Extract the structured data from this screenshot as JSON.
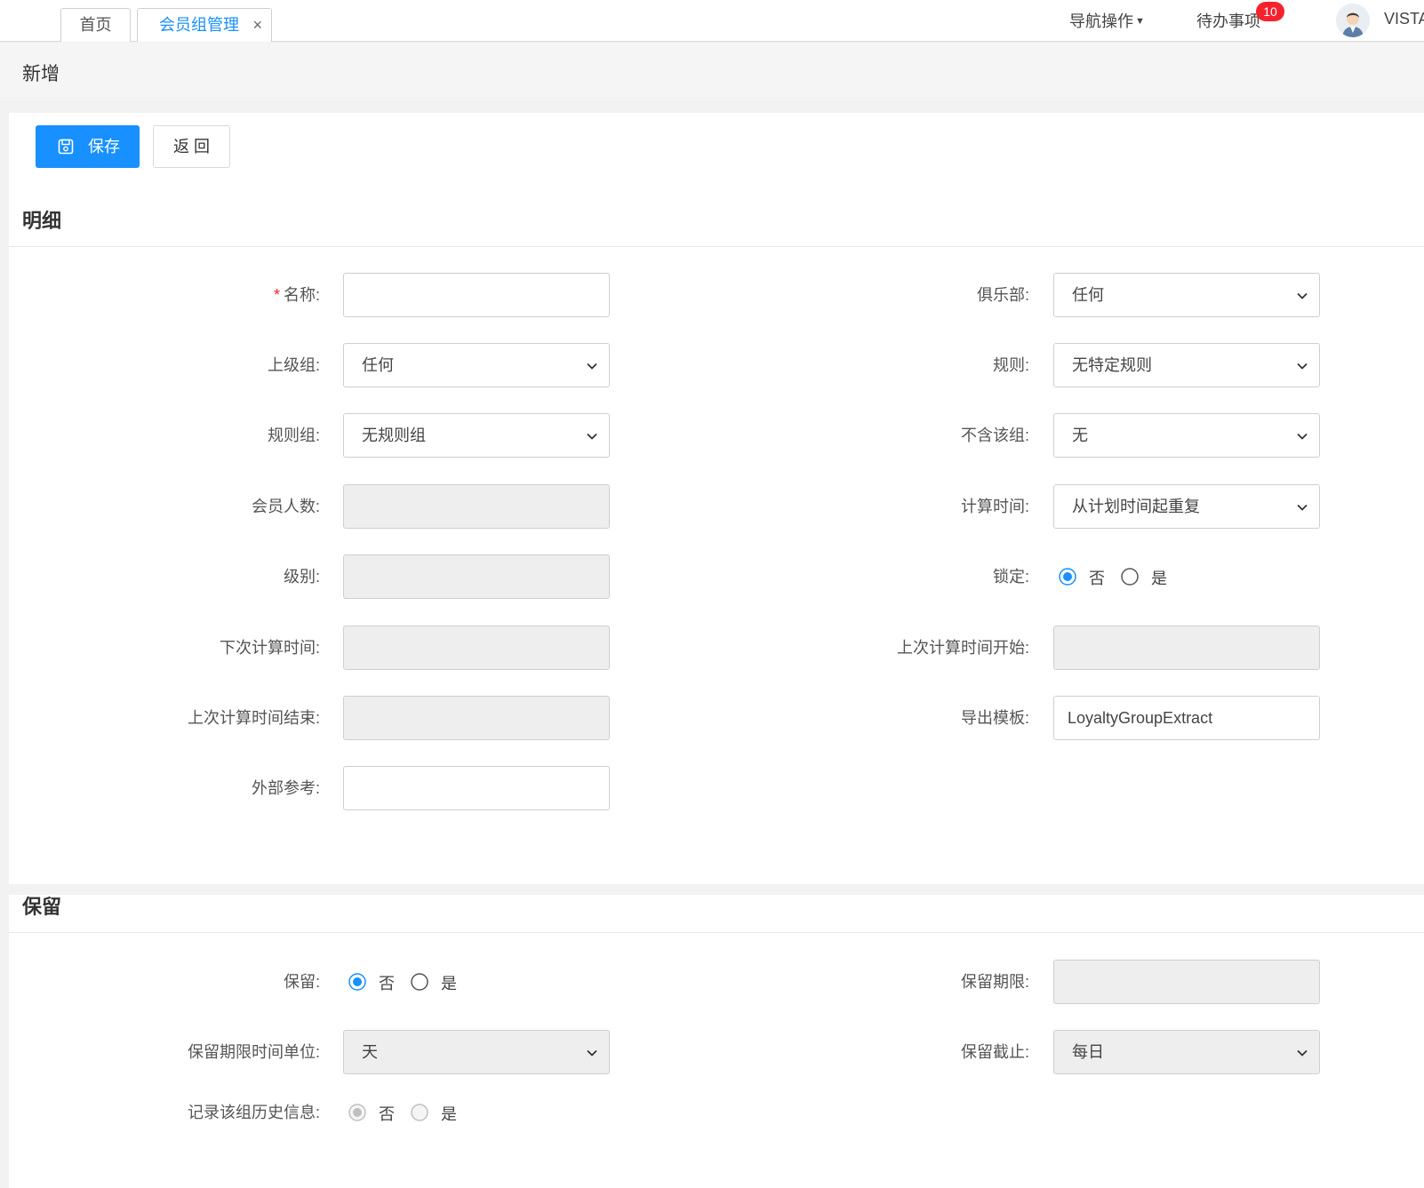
{
  "tabs": {
    "home": "首页",
    "active": "会员组管理",
    "close": "×"
  },
  "header": {
    "nav_ops": "导航操作",
    "todo": "待办事项",
    "todo_count": "10",
    "username": "VISTA"
  },
  "page": {
    "title": "新增"
  },
  "toolbar": {
    "save": "保存",
    "back": "返 回"
  },
  "sections": {
    "detail": "明细",
    "retention": "保留"
  },
  "detail": {
    "name_label": "名称:",
    "name_value": "",
    "club_label": "俱乐部:",
    "club_value": "任何",
    "parent_label": "上级组:",
    "parent_value": "任何",
    "rule_label": "规则:",
    "rule_value": "无特定规则",
    "rulegroup_label": "规则组:",
    "rulegroup_value": "无规则组",
    "exclude_label": "不含该组:",
    "exclude_value": "无",
    "count_label": "会员人数:",
    "count_value": "",
    "calc_label": "计算时间:",
    "calc_value": "从计划时间起重复",
    "level_label": "级别:",
    "level_value": "",
    "lock_label": "锁定:",
    "lock_no": "否",
    "lock_yes": "是",
    "lock_selected": "否",
    "next_calc_label": "下次计算时间:",
    "next_calc_value": "",
    "last_start_label": "上次计算时间开始:",
    "last_start_value": "",
    "last_end_label": "上次计算时间结束:",
    "last_end_value": "",
    "export_label": "导出模板:",
    "export_value": "LoyaltyGroupExtract",
    "external_label": "外部参考:",
    "external_value": ""
  },
  "retention": {
    "keep_label": "保留:",
    "keep_no": "否",
    "keep_yes": "是",
    "keep_selected": "否",
    "period_label": "保留期限:",
    "period_value": "",
    "unit_label": "保留期限时间单位:",
    "unit_value": "天",
    "cutoff_label": "保留截止:",
    "cutoff_value": "每日",
    "history_label": "记录该组历史信息:",
    "history_no": "否",
    "history_yes": "是",
    "history_selected": "否"
  },
  "colors": {
    "accent": "#1890ff",
    "badge": "#f5222d",
    "disabled_bg": "#eeeeee"
  }
}
